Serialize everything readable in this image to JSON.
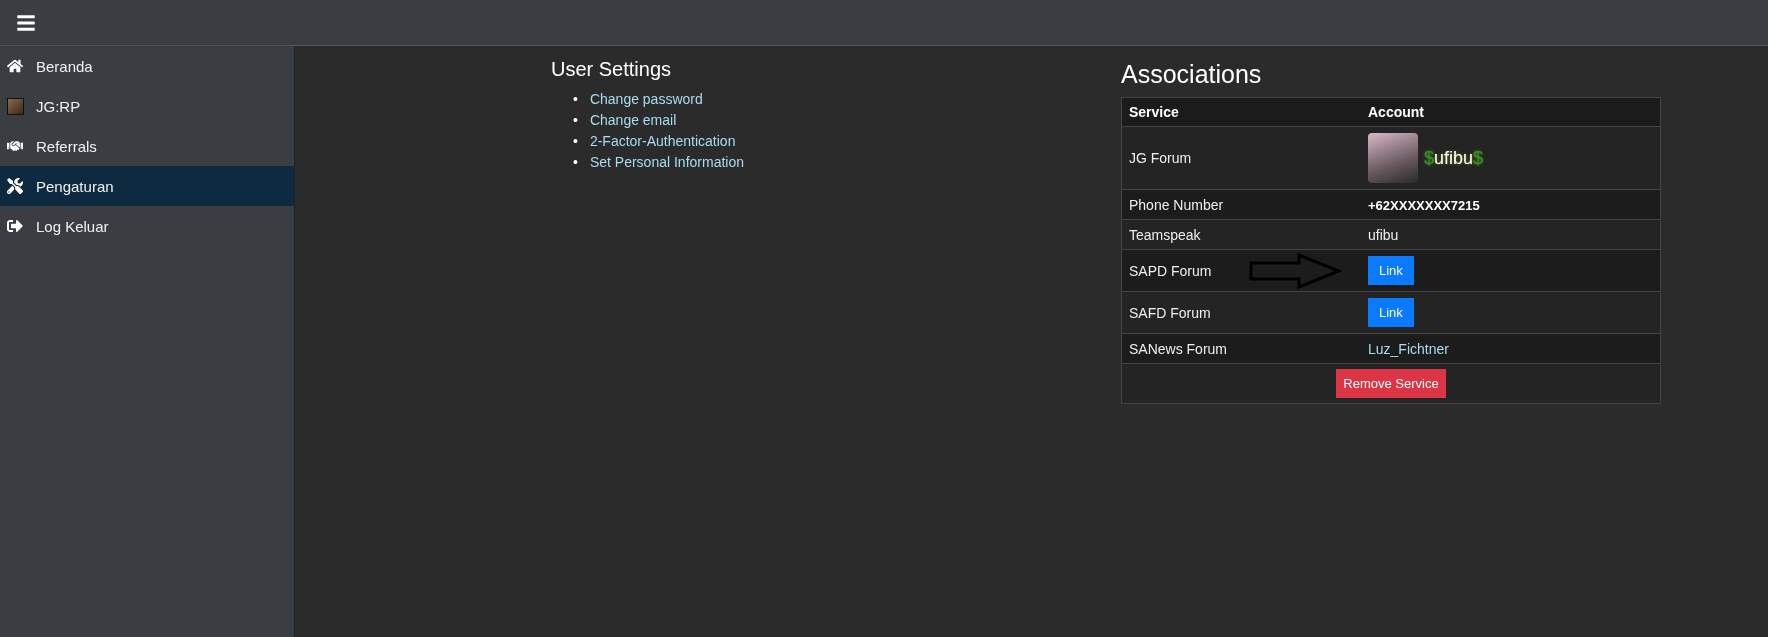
{
  "sidebar": {
    "items": [
      {
        "label": "Beranda",
        "selected": false
      },
      {
        "label": "JG:RP",
        "selected": false
      },
      {
        "label": "Referrals",
        "selected": false
      },
      {
        "label": "Pengaturan",
        "selected": true
      },
      {
        "label": "Log Keluar",
        "selected": false
      }
    ]
  },
  "user_settings": {
    "title": "User Settings",
    "links": [
      {
        "bullet": "•",
        "label": "Change password"
      },
      {
        "bullet": "•",
        "label": "Change email"
      },
      {
        "bullet": "•",
        "label": "2-Factor-Authentication"
      },
      {
        "bullet": "•",
        "label": "Set Personal Information"
      }
    ]
  },
  "associations": {
    "title": "Associations",
    "columns": [
      "Service",
      "Account"
    ],
    "rows": [
      {
        "service": "JG Forum",
        "kind": "user",
        "prefix": "$",
        "account": "ufibu",
        "suffix": "$"
      },
      {
        "service": "Phone Number",
        "kind": "phone",
        "account": "+62XXXXXXX7215"
      },
      {
        "service": "Teamspeak",
        "kind": "text",
        "account": "ufibu"
      },
      {
        "service": "SAPD Forum",
        "kind": "button",
        "account": "Link",
        "arrow": true
      },
      {
        "service": "SAFD Forum",
        "kind": "button",
        "account": "Link",
        "arrow": false
      },
      {
        "service": "SANews Forum",
        "kind": "link",
        "account": "Luz_Fichtner"
      }
    ],
    "remove_button": "Remove Service"
  }
}
